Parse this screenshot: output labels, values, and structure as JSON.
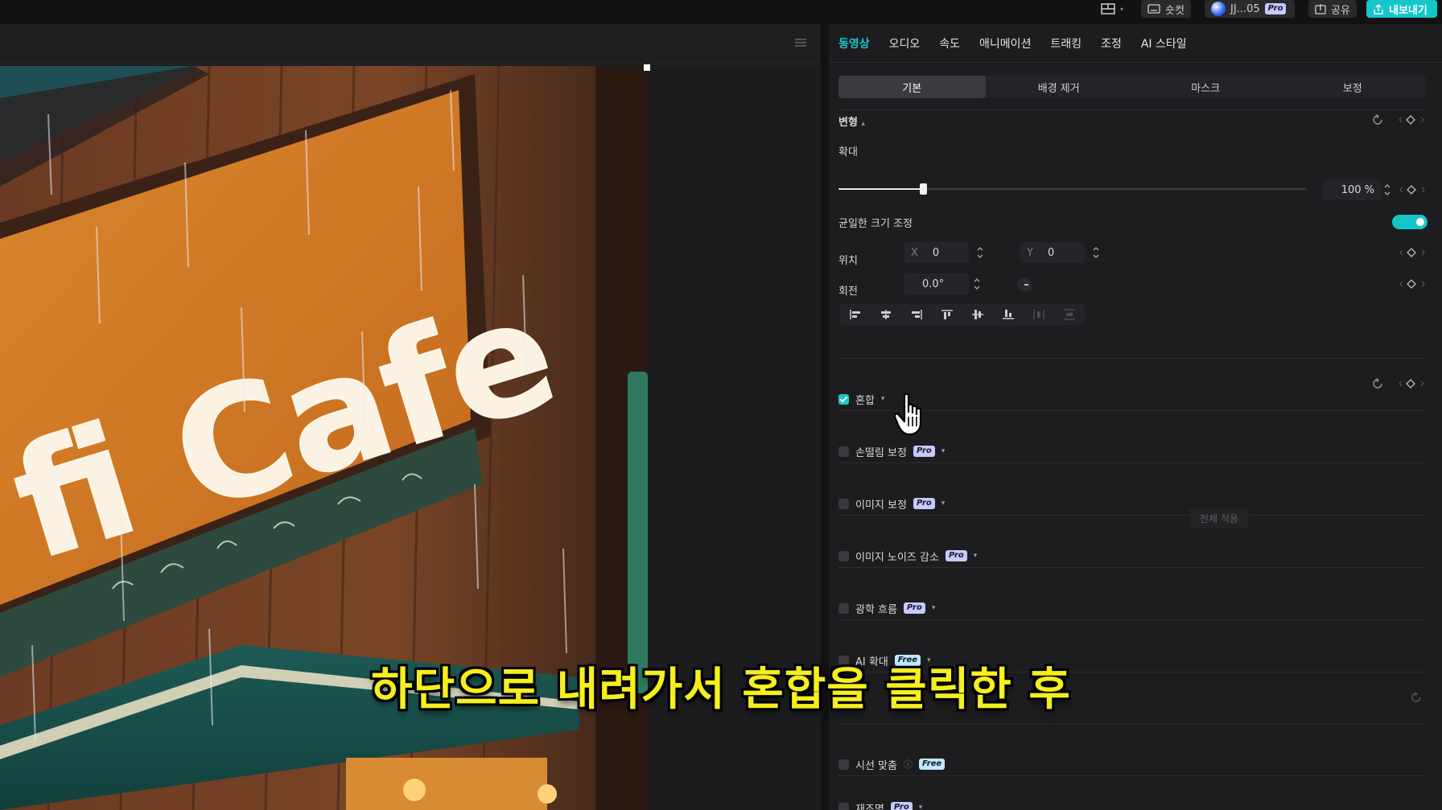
{
  "topbar": {
    "shortcut_label": "숏컷",
    "user_label": "JJ...05",
    "user_badge": "Pro",
    "share_label": "공유",
    "export_label": "내보내기"
  },
  "panel": {
    "main_tabs": [
      "동영상",
      "오디오",
      "속도",
      "애니메이션",
      "트래킹",
      "조정",
      "AI 스타일"
    ],
    "sub_tabs": [
      "기본",
      "배경 제거",
      "마스크",
      "보정"
    ],
    "transform": {
      "title": "변형",
      "scale_label": "확대",
      "scale_value": "100 %",
      "scale_fraction": 0.18,
      "uniform_label": "균일한 크기 조정",
      "position_label": "위치",
      "x_axis": "X",
      "x_value": "0",
      "y_axis": "Y",
      "y_value": "0",
      "rotation_label": "회전",
      "rotation_value": "0.0°"
    },
    "sections": [
      {
        "label": "혼합",
        "checked": true,
        "badge": ""
      },
      {
        "label": "손떨림 보정",
        "checked": false,
        "badge": "Pro"
      },
      {
        "label": "이미지 보정",
        "checked": false,
        "badge": "Pro"
      },
      {
        "label": "이미지 노이즈 감소",
        "checked": false,
        "badge": "Pro"
      },
      {
        "label": "광학 흐름",
        "checked": false,
        "badge": "Pro"
      },
      {
        "label": "AI 확대",
        "checked": false,
        "badge": "Free"
      },
      {
        "label": "시선 맞춤",
        "checked": false,
        "badge": "Free"
      },
      {
        "label": "재조명",
        "checked": false,
        "badge": "Pro"
      }
    ],
    "apply_all_label": "전체 적용"
  },
  "preview": {
    "sign_text": "fi Cafe"
  },
  "subtitle": "하단으로 내려가서 혼합을 클릭한 후",
  "colors": {
    "accent": "#19c7cb",
    "subtitle": "#f6ef1c"
  }
}
